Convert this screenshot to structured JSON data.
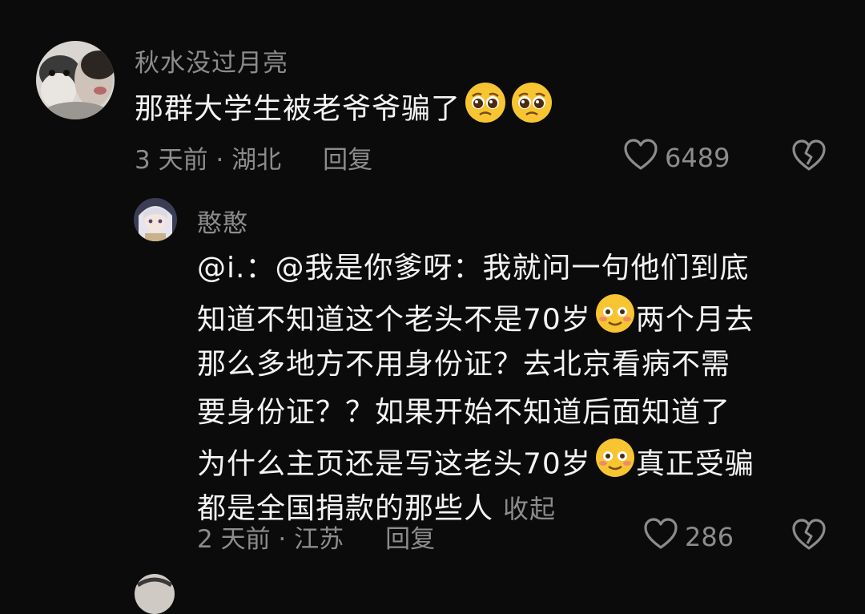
{
  "comments": [
    {
      "username": "秋水没过月亮",
      "text": "那群大学生被老爷爷骗了",
      "emoji": "pleading-face-icon",
      "time_location": "3 天前 · 湖北",
      "reply_label": "回复",
      "likes": "6489"
    },
    {
      "username": "憨憨",
      "lines": [
        "@i.：@我是你爹呀：我就问一句他们到底",
        "知道不知道这个老头不是70岁",
        "两个月去",
        "那么多地方不用身份证？去北京看病不需",
        "要身份证？？如果开始不知道后面知道了",
        "为什么主页还是写这老头70岁",
        "真正受骗",
        "都是全国捐款的那些人"
      ],
      "collapse_label": "收起",
      "emoji": "smiling-blush-face-icon",
      "time_location": "2 天前 · 江苏",
      "reply_label": "回复",
      "likes": "286"
    }
  ],
  "colors": {
    "background": "#0b0b0b",
    "primary_text": "#f4f4f4",
    "secondary_text": "#8c8c8c",
    "emoji_yellow": "#f7c531"
  }
}
